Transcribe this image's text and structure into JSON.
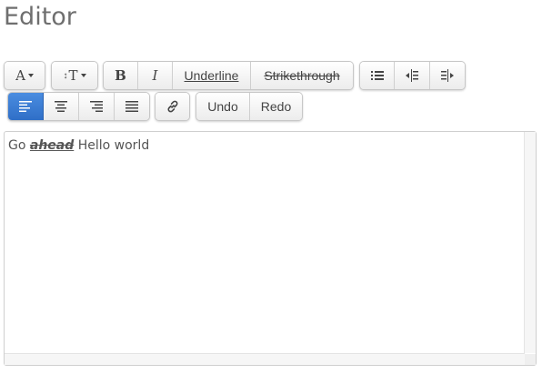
{
  "page": {
    "title": "Editor"
  },
  "toolbar": {
    "font_button": "A",
    "font_size_button": "T",
    "bold": "B",
    "italic": "I",
    "underline": "Underline",
    "strikethrough": "Strikethrough",
    "undo": "Undo",
    "redo": "Redo",
    "icons": {
      "bullet_list": "list-ul-icon",
      "outdent": "outdent-icon",
      "indent": "indent-icon",
      "align_left": "align-left-icon",
      "align_center": "align-center-icon",
      "align_right": "align-right-icon",
      "justify": "align-justify-icon",
      "link": "link-icon"
    },
    "active_color": "#3a7bd5"
  },
  "editor": {
    "segments": [
      "Go ",
      "ahead",
      " Hello world"
    ]
  }
}
